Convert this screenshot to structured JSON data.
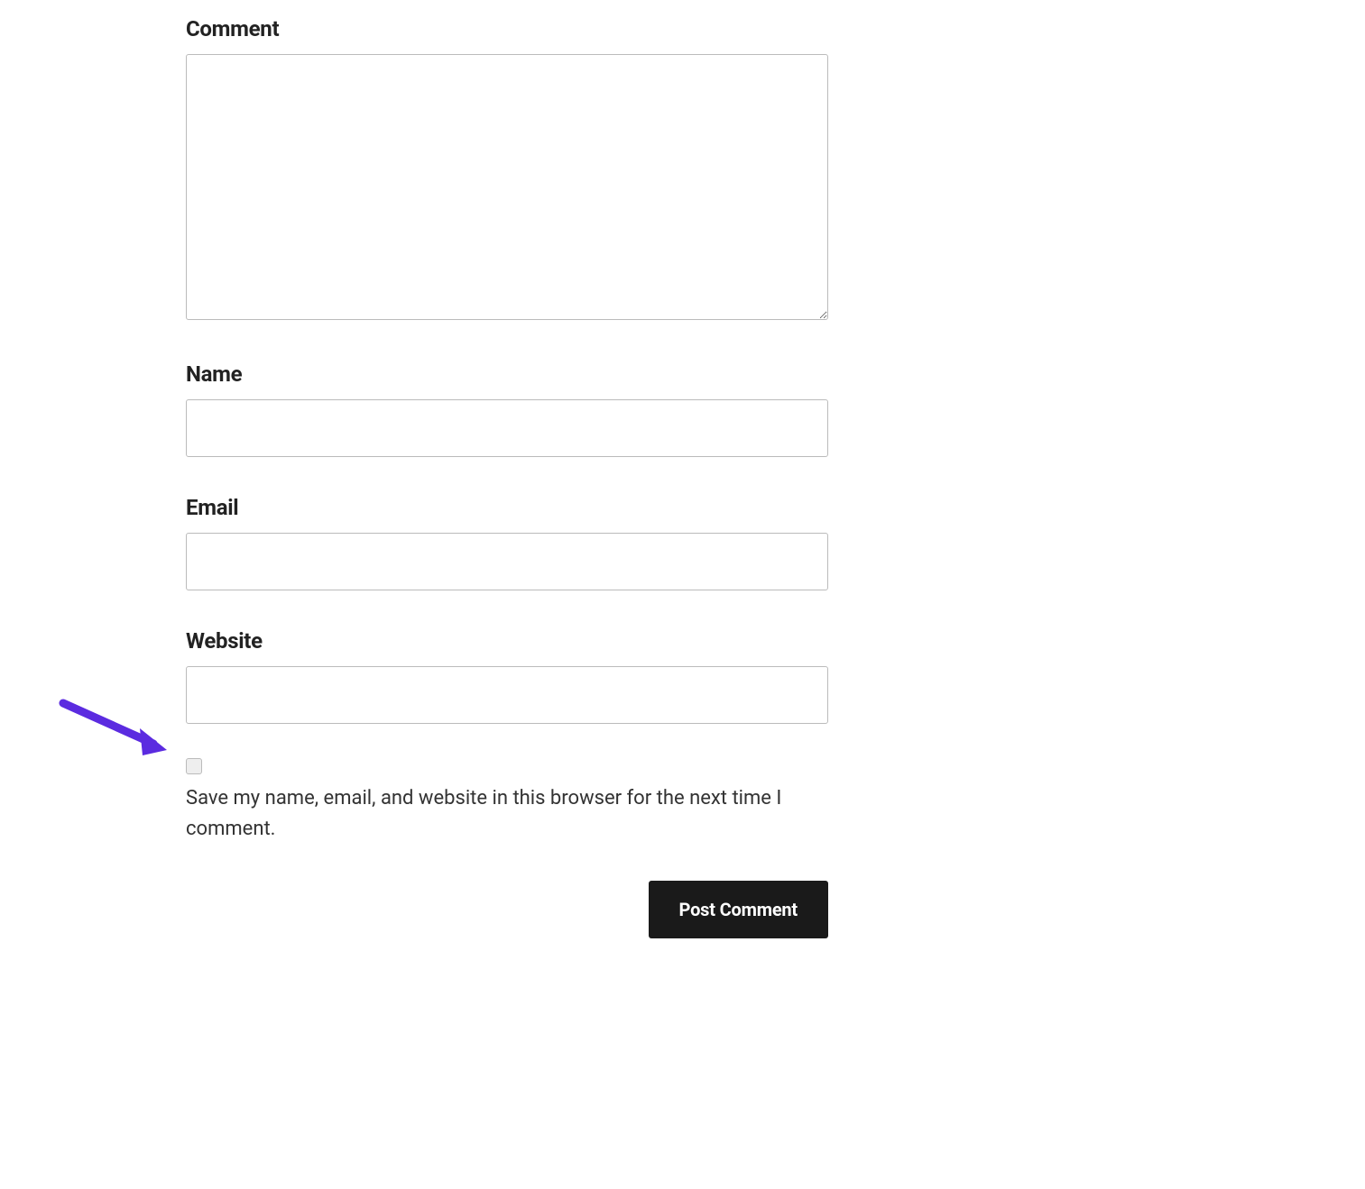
{
  "form": {
    "comment_label": "Comment",
    "name_label": "Name",
    "email_label": "Email",
    "website_label": "Website",
    "save_checkbox_label": "Save my name, email, and website in this browser for the next time I comment.",
    "submit_label": "Post Comment",
    "comment_value": "",
    "name_value": "",
    "email_value": "",
    "website_value": ""
  },
  "annotation": {
    "arrow_color": "#5b2be0"
  }
}
